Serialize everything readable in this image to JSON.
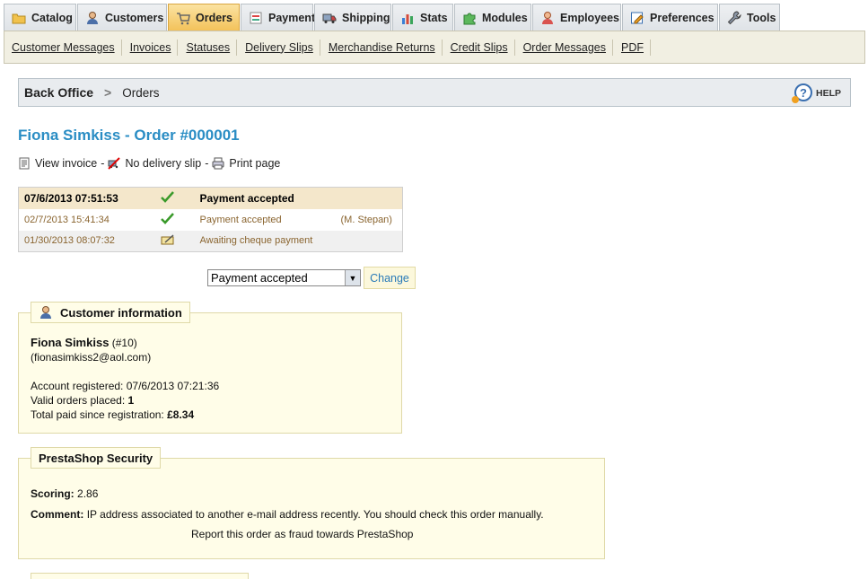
{
  "tabs": [
    {
      "label": "Catalog",
      "icon": "folder-icon",
      "active": false
    },
    {
      "label": "Customers",
      "icon": "user-icon",
      "active": false
    },
    {
      "label": "Orders",
      "icon": "cart-icon",
      "active": true
    },
    {
      "label": "Payment",
      "icon": "payment-icon",
      "active": false
    },
    {
      "label": "Shipping",
      "icon": "truck-icon",
      "active": false
    },
    {
      "label": "Stats",
      "icon": "bar-chart-icon",
      "active": false
    },
    {
      "label": "Modules",
      "icon": "puzzle-icon",
      "active": false
    },
    {
      "label": "Employees",
      "icon": "employee-icon",
      "active": false
    },
    {
      "label": "Preferences",
      "icon": "preferences-icon",
      "active": false
    },
    {
      "label": "Tools",
      "icon": "wrench-icon",
      "active": false
    }
  ],
  "submenu": [
    "Customer Messages",
    "Invoices",
    "Statuses",
    "Delivery Slips",
    "Merchandise Returns",
    "Credit Slips",
    "Order Messages",
    "PDF"
  ],
  "breadcrumb": {
    "root": "Back Office",
    "separator": ">",
    "current": "Orders"
  },
  "help_label": "HELP",
  "page_title": "Fiona Simkiss - Order #000001",
  "actions": {
    "view_invoice": "View invoice",
    "dash": "-",
    "no_delivery": "No delivery slip",
    "print": "Print page"
  },
  "history": [
    {
      "date": "07/6/2013 07:51:53",
      "icon": "checkmark-icon",
      "status": "Payment accepted",
      "employee": ""
    },
    {
      "date": "02/7/2013 15:41:34",
      "icon": "checkmark-icon",
      "status": "Payment accepted",
      "employee": "(M. Stepan)"
    },
    {
      "date": "01/30/2013 08:07:32",
      "icon": "cheque-icon",
      "status": "Awaiting cheque payment",
      "employee": ""
    }
  ],
  "status_select": {
    "value": "Payment accepted",
    "button": "Change"
  },
  "customer": {
    "legend": "Customer information",
    "name": "Fiona Simkiss",
    "id": "(#10)",
    "email": "(fionasimkiss2@aol.com)",
    "registered_label": "Account registered:",
    "registered_value": "07/6/2013 07:21:36",
    "orders_label": "Valid orders placed:",
    "orders_value": "1",
    "paid_label": "Total paid since registration:",
    "paid_value": "£8.34"
  },
  "security": {
    "legend": "PrestaShop Security",
    "scoring_label": "Scoring:",
    "scoring_value": "2.86",
    "comment_label": "Comment:",
    "comment_value": "IP address associated to another e-mail address recently. You should check this order manually.",
    "report_link": "Report this order as fraud towards PrestaShop"
  }
}
